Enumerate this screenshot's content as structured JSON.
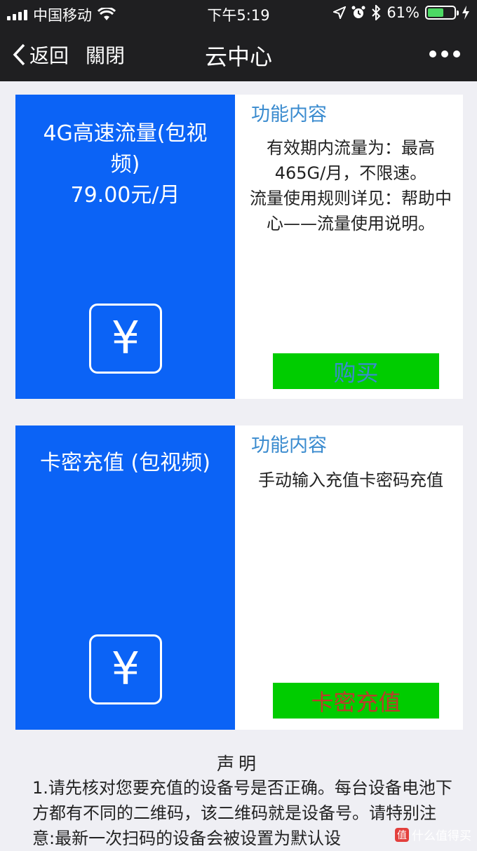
{
  "status_bar": {
    "carrier": "中国移动",
    "time": "下午5:19",
    "battery_percent": "61%",
    "battery_level": 0.61
  },
  "nav": {
    "back_label": "返回",
    "close_label": "關閉",
    "title": "云中心"
  },
  "plans": [
    {
      "name": "4G高速流量(包视频)",
      "price": "79.00元/月",
      "info_heading": "功能内容",
      "description": "有效期内流量为：最高465G/月，不限速。\n流量使用规则详见：帮助中心——流量使用说明。",
      "button_label": "购买",
      "button_text_color": "#3a8bcf"
    },
    {
      "name": "卡密充值 (包视频)",
      "price": "",
      "info_heading": "功能内容",
      "description": "手动输入充值卡密码充值",
      "button_label": "卡密充值",
      "button_text_color": "#c0392b"
    }
  ],
  "notice": {
    "title": "声明",
    "text": "1.请先核对您要充值的设备号是否正确。每台设备电池下方都有不同的二维码，该二维码就是设备号。请特别注意:最新一次扫码的设备会被设置为默认设"
  },
  "watermark": {
    "text": "什么值得买",
    "icon": "值"
  },
  "colors": {
    "nav_bg": "#1f1f21",
    "card_blue": "#0b63f6",
    "button_green": "#00cc00",
    "heading_blue": "#3a8bcf",
    "page_bg": "#efeff4"
  }
}
